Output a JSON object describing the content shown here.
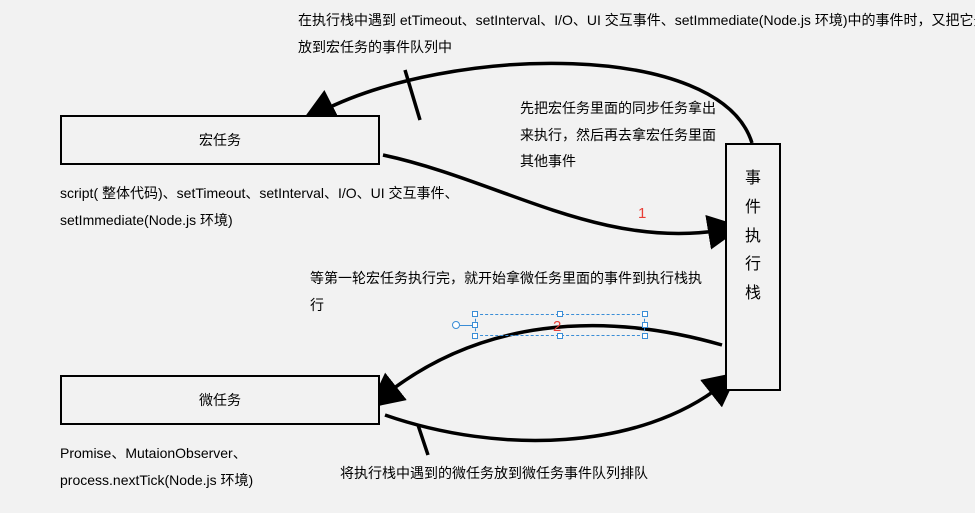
{
  "boxes": {
    "macro_task": "宏任务",
    "micro_task": "微任务",
    "exec_stack_chars": [
      "事",
      "件",
      "执",
      "行",
      "栈"
    ]
  },
  "notes": {
    "top": "在执行栈中遇到 etTimeout、setInterval、I/O、UI 交互事件、setImmediate(Node.js 环境)中的事件时，又把它先放到宏任务的事件队列中",
    "macro_desc": "script( 整体代码)、setTimeout、setInterval、I/O、UI 交互事件、setImmediate(Node.js 环境)",
    "sync": "先把宏任务里面的同步任务拿出来执行，然后再去拿宏任务里面其他事件",
    "micro_loop": "等第一轮宏任务执行完，就开始拿微任务里面的事件到执行栈执行",
    "micro_desc": "Promise、MutaionObserver、process.nextTick(Node.js 环境)",
    "micro_queue": "将执行栈中遇到的微任务放到微任务事件队列排队"
  },
  "numbers": {
    "one": "1",
    "two": "2"
  }
}
